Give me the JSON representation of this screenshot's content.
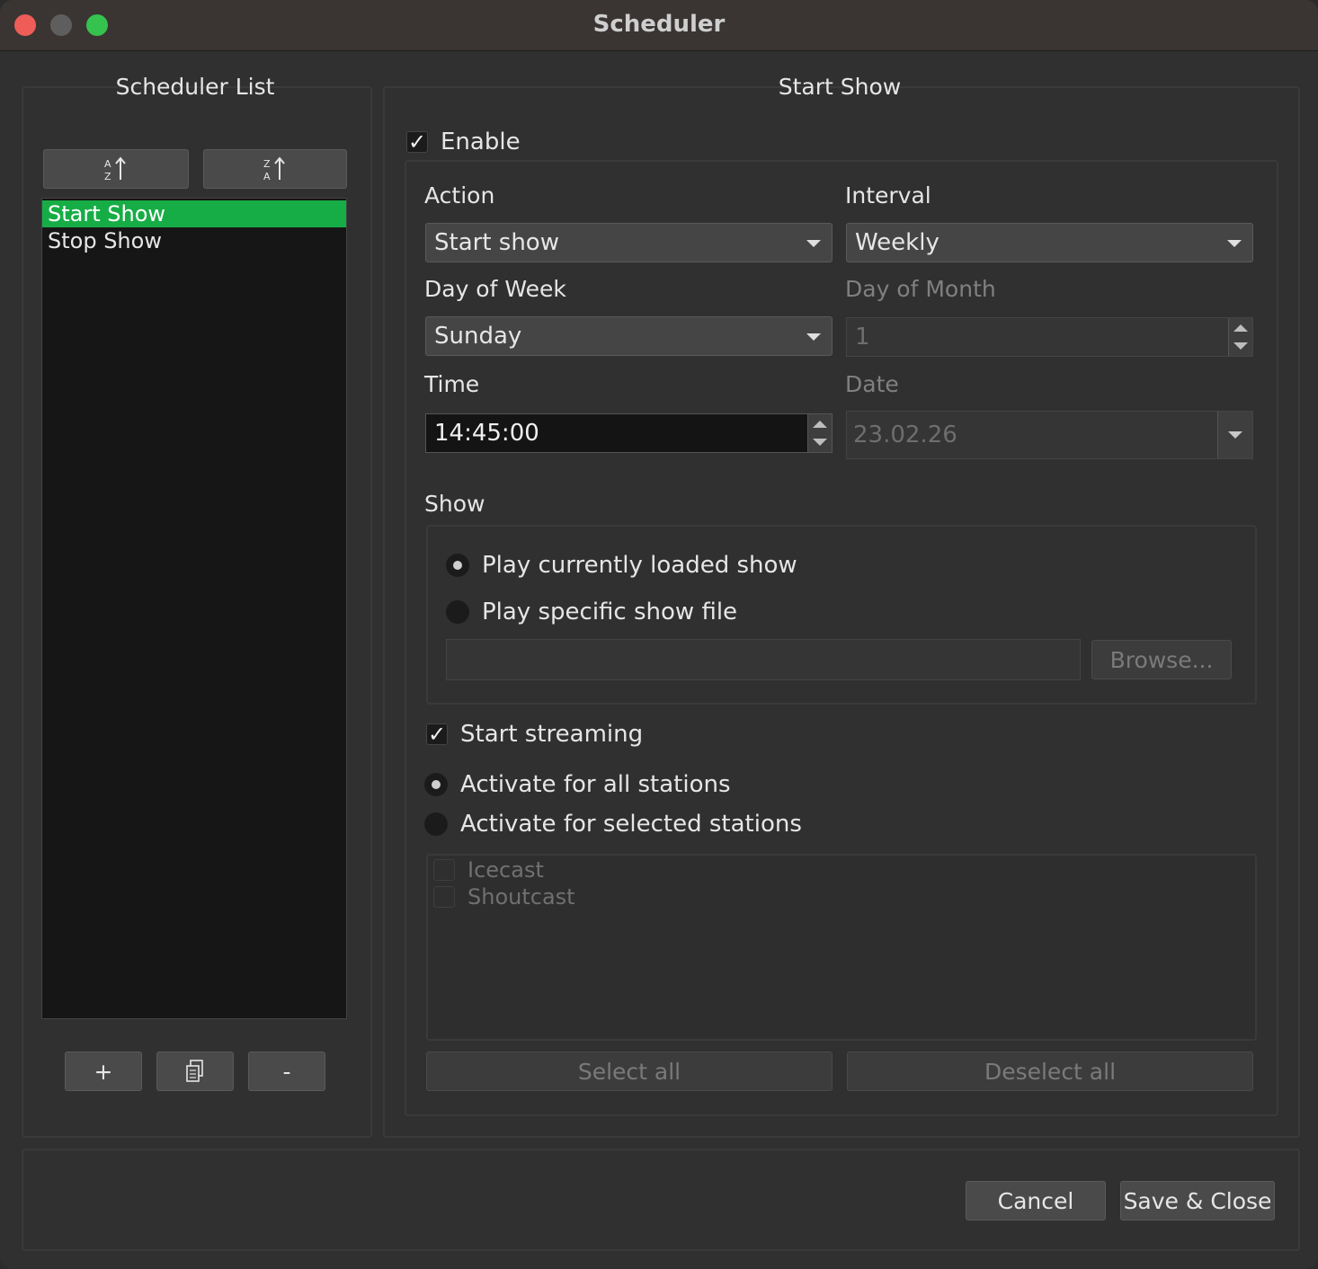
{
  "window": {
    "title": "Scheduler"
  },
  "left": {
    "title": "Scheduler List",
    "sort_az_icon": "sort-ascending-icon",
    "sort_za_icon": "sort-descending-icon",
    "items": [
      {
        "label": "Start Show",
        "selected": true
      },
      {
        "label": "Stop Show",
        "selected": false
      }
    ],
    "add_label": "+",
    "duplicate_icon": "copy-icon",
    "remove_label": "-"
  },
  "right": {
    "title": "Start Show",
    "enable_label": "Enable",
    "enable_checked": true,
    "action_label": "Action",
    "action_value": "Start show",
    "interval_label": "Interval",
    "interval_value": "Weekly",
    "dow_label": "Day of Week",
    "dow_value": "Sunday",
    "dom_label": "Day of Month",
    "dom_value": "1",
    "time_label": "Time",
    "time_value": "14:45:00",
    "date_label": "Date",
    "date_value": "23.02.26",
    "show_label": "Show",
    "play_loaded_label": "Play currently loaded show",
    "play_specific_label": "Play specific show file",
    "show_file_value": "",
    "browse_label": "Browse...",
    "streaming_label": "Start streaming",
    "streaming_checked": true,
    "all_stations_label": "Activate for all stations",
    "selected_stations_label": "Activate for selected stations",
    "stations": [
      "Icecast",
      "Shoutcast"
    ],
    "select_all_label": "Select all",
    "deselect_all_label": "Deselect all"
  },
  "footer": {
    "cancel_label": "Cancel",
    "save_label": "Save & Close"
  }
}
